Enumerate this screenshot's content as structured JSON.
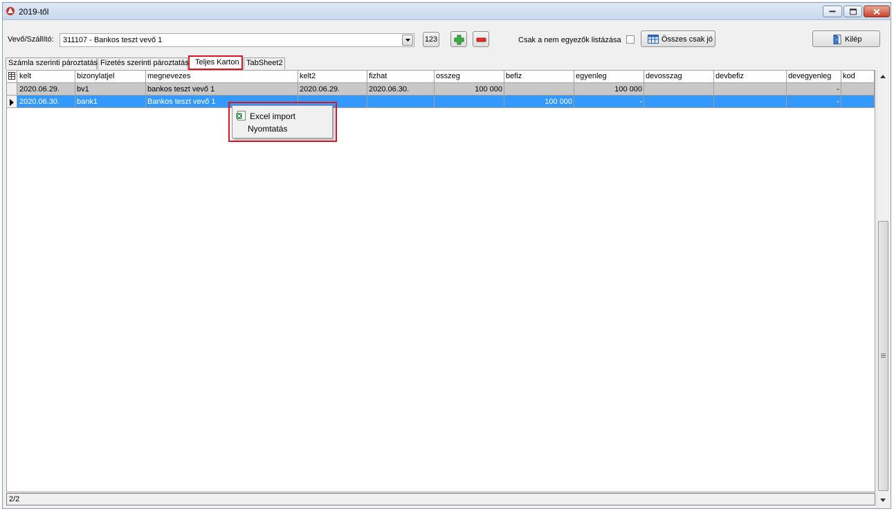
{
  "window": {
    "title": "2019-től"
  },
  "toolbar": {
    "customer_label": "Vevő/Szállító:",
    "customer_value": "311107 - Bankos teszt vevő 1",
    "btn_123": "123",
    "only_mismatch_label": "Csak a nem egyezők listázása",
    "only_mismatch_checked": false,
    "all_ok_label": "Összes csak jó",
    "exit_label": "Kilép"
  },
  "tabs": [
    {
      "label": "Számla szerinti pároztatás",
      "active": false
    },
    {
      "label": "Fizetés szerinti pároztatás",
      "active": false
    },
    {
      "label": "Teljes Karton",
      "active": true
    },
    {
      "label": "TabSheet2",
      "active": false
    }
  ],
  "grid": {
    "columns": [
      "kelt",
      "bizonylatjel",
      "megnevezes",
      "kelt2",
      "fizhat",
      "osszeg",
      "befiz",
      "egyenleg",
      "devosszag",
      "devbefiz",
      "devegyenleg",
      "kod"
    ],
    "rows": [
      [
        "2020.06.29.",
        "bv1",
        "bankos teszt vevő 1",
        "2020.06.29.",
        "2020.06.30.",
        "100 000",
        "",
        "100 000",
        "",
        "",
        "-",
        ""
      ],
      [
        "2020.06.30.",
        "bank1",
        "Bankos teszt vevő 1",
        "",
        "",
        "",
        "100 000",
        "-",
        "",
        "",
        "-",
        ""
      ]
    ],
    "selected_row": 1
  },
  "context_menu": {
    "items": [
      {
        "label": "Excel import",
        "icon": "excel-icon"
      },
      {
        "label": "Nyomtatás",
        "icon": ""
      }
    ]
  },
  "status": {
    "record_count": "2/2"
  },
  "colors": {
    "selection": "#3399ff",
    "highlight_border": "#e0141e",
    "row_gray": "#c8c8c8"
  }
}
